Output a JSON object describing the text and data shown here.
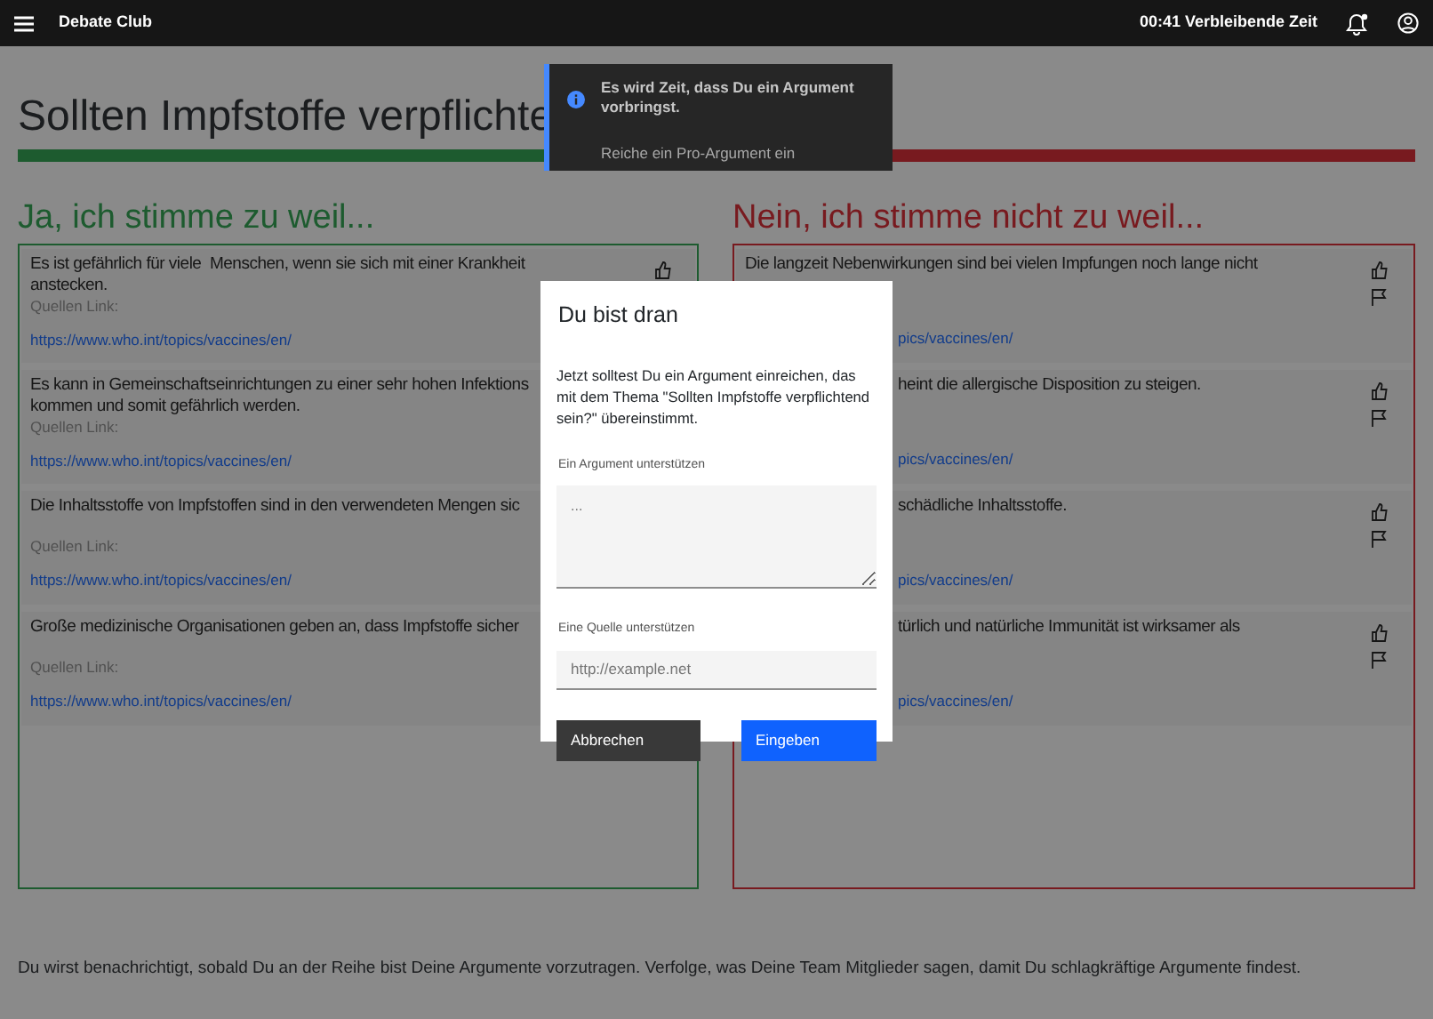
{
  "app_bar": {
    "title": "Debate Club",
    "timer": "00:41 Verbleibende Zeit",
    "notification_badge": true
  },
  "topic": {
    "title": "Sollten Impfstoffe verpflichte"
  },
  "pro": {
    "heading": "Ja, ich stimme zu weil...",
    "arguments": [
      {
        "text": "Es ist gefährlich für viele  Menschen, wenn sie sich mit einer Krankheit\nanstecken.",
        "source_label": "Quellen Link:",
        "source_link": "https://www.who.int/topics/vaccines/en/",
        "like_button": true,
        "text_cut_left": false,
        "link_cut_left": false
      },
      {
        "text": "Es kann in Gemeinschaftseinrichtungen zu einer sehr hohen Infektions\nkommen und somit gefährlich werden.",
        "source_label": "Quellen Link:",
        "source_link": "https://www.who.int/topics/vaccines/en/",
        "text_cut_left": false,
        "link_cut_left": false
      },
      {
        "text": "Die Inhaltsstoffe von Impfstoffen sind in den verwendeten Mengen sic",
        "source_label": "Quellen Link:",
        "source_link": "https://www.who.int/topics/vaccines/en/",
        "text_cut_left": false,
        "link_cut_left": false
      },
      {
        "text": "Große medizinische Organisationen geben an, dass Impfstoffe sicher",
        "source_label": "Quellen Link:",
        "source_link": "https://www.who.int/topics/vaccines/en/",
        "text_cut_left": false,
        "link_cut_left": false
      }
    ]
  },
  "contra": {
    "heading": "Nein, ich stimme nicht zu weil...",
    "arguments": [
      {
        "text": "Die langzeit Nebenwirkungen sind bei vielen Impfungen noch lange nicht",
        "source_link": "pics/vaccines/en/",
        "like_button": true,
        "flag_button": true,
        "text_cut_left": false,
        "link_cut_left": true
      },
      {
        "text": "heint die allergische Disposition zu steigen.",
        "source_link": "pics/vaccines/en/",
        "like_button": true,
        "flag_button": true,
        "text_cut_left": true,
        "link_cut_left": true
      },
      {
        "text": "schädliche Inhaltsstoffe.",
        "source_link": "pics/vaccines/en/",
        "like_button": true,
        "flag_button": true,
        "text_cut_left": true,
        "link_cut_left": true
      },
      {
        "text": "türlich und natürliche Immunität ist wirksamer als",
        "source_link": "pics/vaccines/en/",
        "like_button": true,
        "flag_button": true,
        "text_cut_left": true,
        "link_cut_left": true
      }
    ]
  },
  "footer_note": "Du wirst benachrichtigt, sobald Du an der Reihe bist Deine Argumente vorzutragen. Verfolge, was Deine Team Mitglieder sagen, damit Du schlagkräftige Argumente findest.",
  "toast": {
    "title": "Es wird Zeit, dass Du ein Argument vorbringst.",
    "message": "Reiche ein Pro-Argument ein"
  },
  "modal": {
    "title": "Du bist dran",
    "body": "Jetzt solltest Du ein Argument einreichen, das mit dem Thema \"Sollten Impfstoffe verpflichtend sein?\" übereinstimmt.",
    "fields": [
      {
        "kind": "textarea",
        "label": "Ein Argument unterstützen",
        "placeholder": "..."
      },
      {
        "kind": "input",
        "label": "Eine Quelle unterstützen",
        "placeholder": "http://example.net"
      }
    ],
    "buttons": [
      {
        "kind": "secondary",
        "label": "Abbrechen"
      },
      {
        "kind": "primary",
        "label": "Eingeben"
      }
    ]
  }
}
